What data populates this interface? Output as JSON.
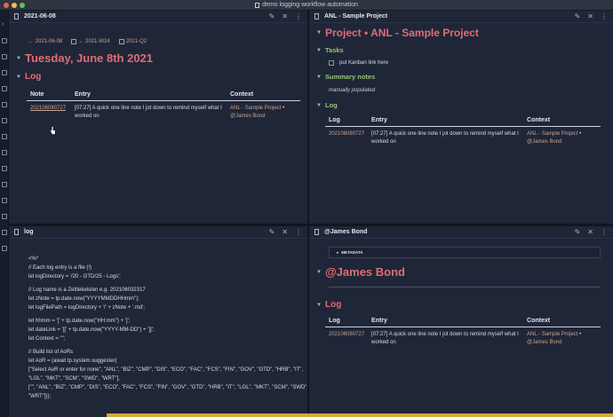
{
  "window": {
    "title": "demo logging workflow automation",
    "traffic": [
      "#ee5f57",
      "#f5bd4f",
      "#5fc455"
    ]
  },
  "pane_daily": {
    "title": "2021-06-08",
    "nav": {
      "prev_day": "← 2021-06-08",
      "prev_week": "← 2021-W24",
      "quarter": "2021-Q2"
    },
    "heading": "Tuesday, June 8th 2021",
    "log_heading": "Log",
    "table": {
      "headers": [
        "Note",
        "Entry",
        "Context"
      ],
      "rows": [
        {
          "note": "202106080727",
          "entry": "[07:27] A quick one line note I jot down to remind myself what I worked on",
          "context_project": "ANL - Sample Project",
          "context_sep": " •",
          "context_person": "@James Bond"
        }
      ]
    }
  },
  "pane_project": {
    "title": "ANL - Sample Project",
    "heading": "Project • ANL - Sample Project",
    "tasks_heading": "Tasks",
    "task_item": "put Kanban link here",
    "summary_heading": "Summary notes",
    "summary_text": "manually populated",
    "log_heading": "Log",
    "table": {
      "headers": [
        "Log",
        "Entry",
        "Context"
      ],
      "rows": [
        {
          "note": "202106080727",
          "entry": "[07:27] A quick one line note I jot down to remind myself what I worked on",
          "context_project": "ANL - Sample Project",
          "context_sep": " •",
          "context_person": "@James Bond"
        }
      ]
    }
  },
  "pane_log": {
    "title": "log",
    "code_lines": [
      "<%*",
      "// Each log entry is a file (!)",
      "let logDirectory = '/20 - GTD/25 - Logs';",
      "",
      "// Log name is a Zettlekelsten e.g. 202106032317",
      "let zNote = tp.date.now(\"YYYYMMDDHHmm\");",
      "let logFilePath = logDirectory + '/' + zNote + '.md';",
      "",
      "let hhmm = '[' + tp.date.now(\"HH:mm\") + ']';",
      "let dateLink = '[[' + tp.date.now(\"YYYY-MM-DD\") + ']]';",
      "let Context = \"\";",
      "",
      "// Build list of AoRs",
      "let AoR = (await tp.system.suggester(",
      "[\"Select AoR or enter for none\", \"ANL\", \"BIZ\", \"CMP\", \"DIS\", \"ECO\", \"FAC\", \"FCS\", \"FIN\", \"GOV\", \"GTD\", \"HRB\", \"IT\",",
      "\"LGL\", \"MKT\", \"SCM\", \"SWD\", \"WRT\"],",
      "[\"\", \"ANL\", \"BIZ\", \"CMP\", \"DIS\", \"ECO\", \"FAC\", \"FCS\", \"FIN\", \"GOV\", \"GTD\", \"HRB\", \"IT\", \"LGL\", \"MKT\", \"SCM\", \"SWD\",",
      "\"WRT\"]));"
    ]
  },
  "pane_person": {
    "title": "@James Bond",
    "metadata_label": "METADATA",
    "heading": "@James Bond",
    "log_heading": "Log",
    "table": {
      "headers": [
        "Log",
        "Entry",
        "Context"
      ],
      "rows": [
        {
          "note": "202106080727",
          "entry": "[07:27] A quick one line note I jot down to remind myself what I worked on",
          "context_project": "ANL - Sample Project",
          "context_sep": " •",
          "context_person": "@James Bond"
        }
      ]
    }
  },
  "icons": {
    "pencil": "✎",
    "close": "✕",
    "more": "⋮",
    "collapse_open": "▼",
    "collapse_closed": "▸"
  }
}
